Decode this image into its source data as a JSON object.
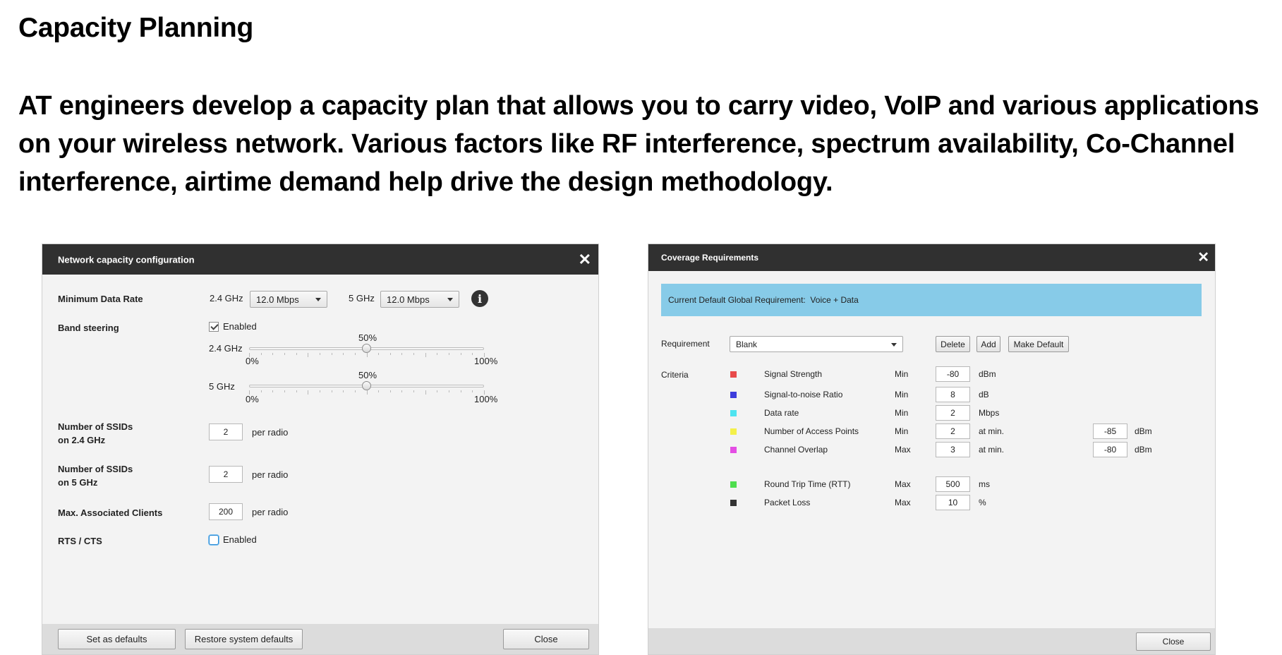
{
  "page": {
    "heading": "Capacity Planning",
    "intro": "AT engineers develop a capacity plan that allows you to carry video, VoIP and various applications on your wireless network. Various factors like RF interference, spectrum availability, Co-Channel interference, airtime demand help drive the design methodology."
  },
  "network_dialog": {
    "title": "Network capacity configuration",
    "close_icon": "close-icon",
    "min_rate": {
      "label": "Minimum Data Rate",
      "band24_label": "2.4 GHz",
      "band24_value": "12.0 Mbps",
      "band5_label": "5 GHz",
      "band5_value": "12.0 Mbps",
      "info_icon": "info-icon",
      "info_glyph": "i"
    },
    "band_steering": {
      "label": "Band steering",
      "enabled_label": "Enabled",
      "enabled": true,
      "sliders": [
        {
          "band": "2.4 GHz",
          "value_label": "50%",
          "value": 0.5,
          "min_label": "0%",
          "max_label": "100%"
        },
        {
          "band": "5 GHz",
          "value_label": "50%",
          "value": 0.5,
          "min_label": "0%",
          "max_label": "100%"
        }
      ]
    },
    "ssids_24": {
      "label_line1": "Number of SSIDs",
      "label_line2": "on 2.4 GHz",
      "value": "2",
      "unit": "per radio"
    },
    "ssids_5": {
      "label_line1": "Number of SSIDs",
      "label_line2": "on 5 GHz",
      "value": "2",
      "unit": "per radio"
    },
    "max_clients": {
      "label": "Max. Associated Clients",
      "value": "200",
      "unit": "per radio"
    },
    "rts_cts": {
      "label": "RTS / CTS",
      "enabled_label": "Enabled",
      "enabled": false
    },
    "footer": {
      "set_defaults": "Set as defaults",
      "restore_defaults": "Restore system defaults",
      "close": "Close"
    }
  },
  "coverage_dialog": {
    "title": "Coverage Requirements",
    "close_icon": "close-icon",
    "banner": "Current Default Global Requirement:  Voice + Data",
    "banner_color": "#87cbe8",
    "requirement": {
      "label": "Requirement",
      "value": "Blank",
      "delete": "Delete",
      "add": "Add",
      "make_default": "Make Default"
    },
    "criteria_label": "Criteria",
    "criteria": [
      {
        "color": "#e84a4a",
        "name": "Signal Strength",
        "limit": "Min",
        "value": "-80",
        "unit": "dBm"
      },
      {
        "color": "#3d3ddc",
        "name": "Signal-to-noise Ratio",
        "limit": "Min",
        "value": "8",
        "unit": "dB"
      },
      {
        "color": "#4ee4f0",
        "name": "Data rate",
        "limit": "Min",
        "value": "2",
        "unit": "Mbps"
      },
      {
        "color": "#f4f04a",
        "name": "Number of Access Points",
        "limit": "Min",
        "value": "2",
        "unit": "at min.",
        "extra_value": "-85",
        "extra_unit": "dBm"
      },
      {
        "color": "#e44ee4",
        "name": "Channel Overlap",
        "limit": "Max",
        "value": "3",
        "unit": "at min.",
        "extra_value": "-80",
        "extra_unit": "dBm"
      },
      {
        "color": "#4ede4e",
        "name": "Round Trip Time (RTT)",
        "limit": "Max",
        "value": "500",
        "unit": "ms"
      },
      {
        "color": "#333333",
        "name": "Packet Loss",
        "limit": "Max",
        "value": "10",
        "unit": "%"
      }
    ],
    "footer": {
      "close": "Close"
    }
  }
}
